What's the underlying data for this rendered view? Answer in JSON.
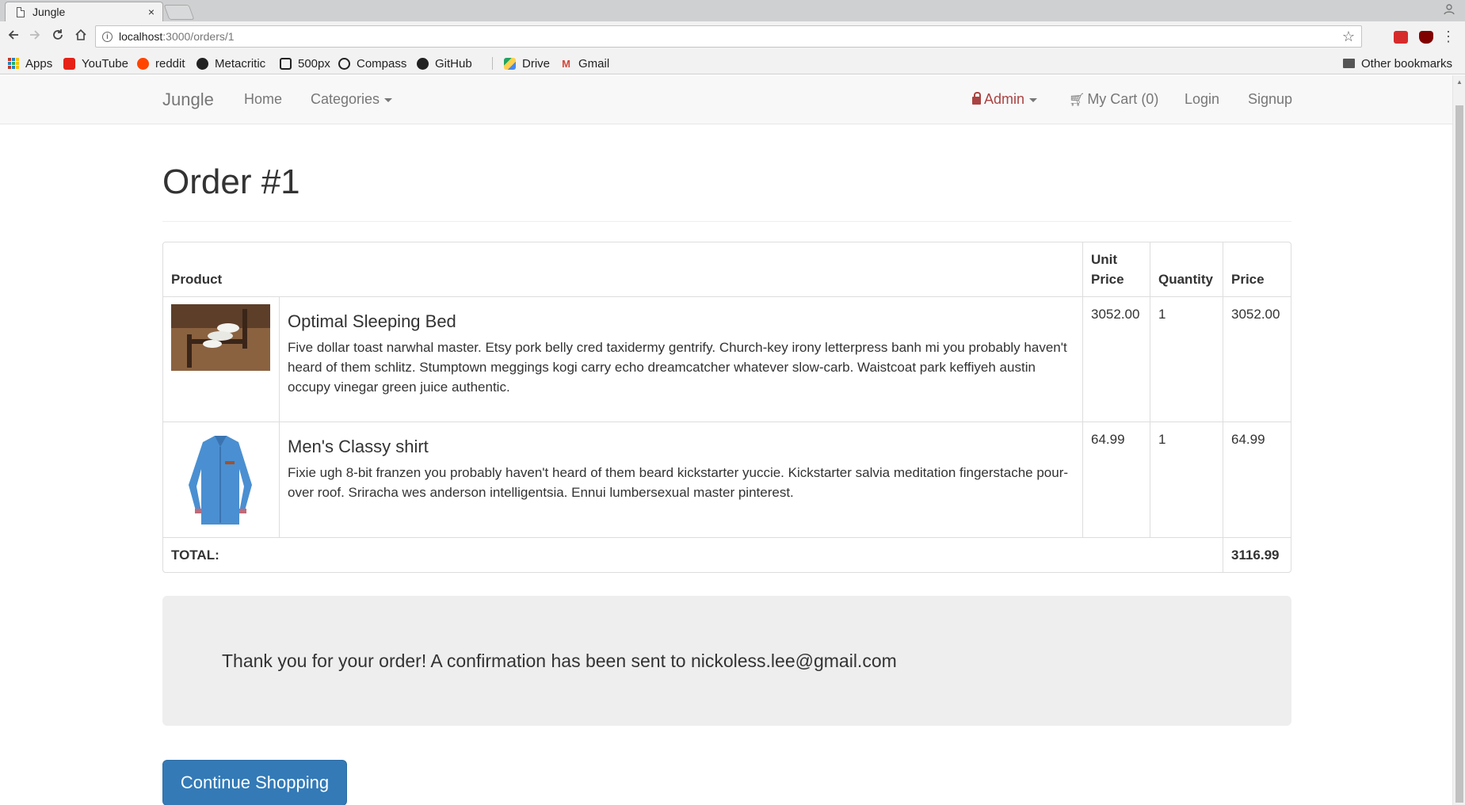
{
  "browser": {
    "tab_title": "Jungle",
    "tab_close": "×",
    "url_host": "localhost",
    "url_path": ":3000/orders/1",
    "bookmarks": [
      {
        "label": "Apps",
        "icon": "apps-grid-icon"
      },
      {
        "label": "YouTube",
        "icon": "youtube-icon",
        "color": "#e62117"
      },
      {
        "label": "reddit",
        "icon": "reddit-icon",
        "color": "#ff4500"
      },
      {
        "label": "Metacritic",
        "icon": "metacritic-icon",
        "color": "#222222"
      },
      {
        "label": "500px",
        "icon": "500px-icon",
        "color": "#222222"
      },
      {
        "label": "Compass",
        "icon": "compass-icon",
        "color": "#222222"
      },
      {
        "label": "GitHub",
        "icon": "github-icon",
        "color": "#222222"
      },
      {
        "label": "Drive",
        "icon": "drive-icon",
        "color": "#1fa463"
      },
      {
        "label": "Gmail",
        "icon": "gmail-icon",
        "color": "#d44638"
      }
    ],
    "other_bookmarks": "Other bookmarks"
  },
  "navbar": {
    "brand": "Jungle",
    "home": "Home",
    "categories": "Categories",
    "admin": "Admin",
    "cart": "My Cart (0)",
    "login": "Login",
    "signup": "Signup"
  },
  "page": {
    "title": "Order #1"
  },
  "table": {
    "headers": {
      "product": "Product",
      "unit_price": "Unit Price",
      "quantity": "Quantity",
      "price": "Price"
    },
    "rows": [
      {
        "name": "Optimal Sleeping Bed",
        "description": "Five dollar toast narwhal master. Etsy pork belly cred taxidermy gentrify. Church-key irony letterpress banh mi you probably haven't heard of them schlitz. Stumptown meggings kogi carry echo dreamcatcher whatever slow-carb. Waistcoat park keffiyeh austin occupy vinegar green juice authentic.",
        "unit_price": "3052.00",
        "quantity": "1",
        "price": "3052.00"
      },
      {
        "name": "Men's Classy shirt",
        "description": "Fixie ugh 8-bit franzen you probably haven't heard of them beard kickstarter yuccie. Kickstarter salvia meditation fingerstache pour-over roof. Sriracha wes anderson intelligentsia. Ennui lumbersexual master pinterest.",
        "unit_price": "64.99",
        "quantity": "1",
        "price": "64.99"
      }
    ],
    "total_label": "TOTAL:",
    "total_value": "3116.99"
  },
  "confirmation": "Thank you for your order! A confirmation has been sent to nickoless.lee@gmail.com",
  "continue_button": "Continue Shopping",
  "colors": {
    "primary": "#337ab7",
    "admin": "#a94442",
    "navbar_bg": "#f8f8f8",
    "jumbotron_bg": "#eeeeee"
  }
}
